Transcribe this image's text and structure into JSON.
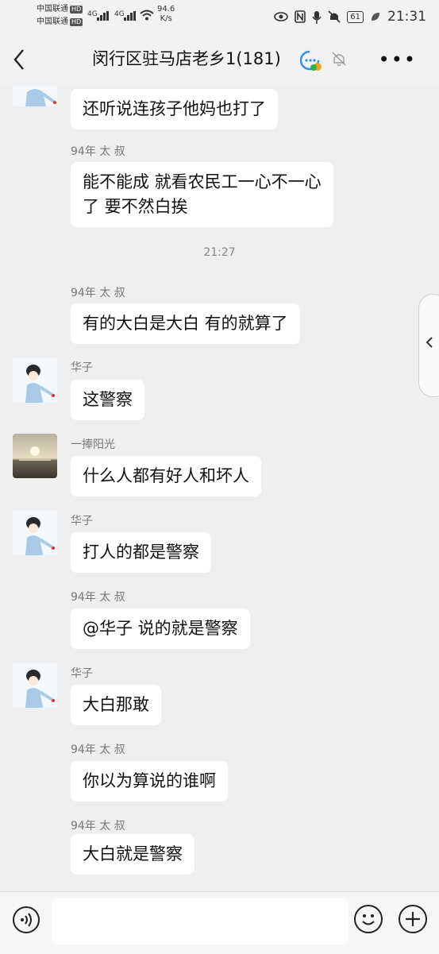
{
  "status_bar": {
    "carrier_1": "中国联通",
    "carrier_2": "中国联通",
    "hd": "HD",
    "net_1": "4G",
    "net_2": "4G",
    "net_speed": "94.6",
    "net_unit": "K/s",
    "battery": "61",
    "time": "21:31"
  },
  "header": {
    "title": "闵行区驻马店老乡1(181)",
    "more": "•••"
  },
  "messages": [
    {
      "sender": "",
      "text": "还听说连孩子他妈也打了"
    },
    {
      "sender": "94年 太 叔",
      "text": "能不能成  就看农民工一心不一心\n了  要不然白挨"
    },
    {
      "sender": "94年 太 叔",
      "text": "有的大白是大白  有的就算了"
    },
    {
      "sender": "华子",
      "text": "这警察"
    },
    {
      "sender": "一捧阳光",
      "text": "什么人都有好人和坏人"
    },
    {
      "sender": "华子",
      "text": "打人的都是警察"
    },
    {
      "sender": "94年 太 叔",
      "text": "@华子  说的就是警察"
    },
    {
      "sender": "华子",
      "text": "大白那敢"
    },
    {
      "sender": "94年 太 叔",
      "text": "你以为算说的谁啊"
    },
    {
      "sender": "94年 太 叔",
      "text": "大白就是警察"
    }
  ],
  "timestamp": "21:27",
  "colors": {
    "background": "#efefef",
    "bubble": "#ffffff",
    "name": "#777777"
  },
  "icons": [
    "back-arrow-icon",
    "group-badge-icon",
    "mute-bell-icon",
    "voice-icon",
    "emoji-icon",
    "plus-icon",
    "chevron-left-icon"
  ]
}
